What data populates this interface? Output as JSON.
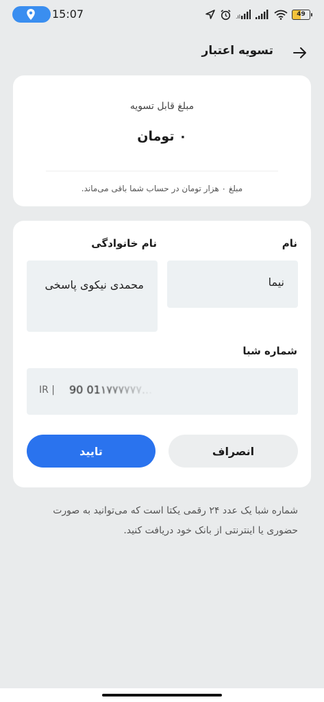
{
  "status_bar": {
    "time": "15:07",
    "battery": "49"
  },
  "header": {
    "title": "تسویه اعتبار"
  },
  "balance_card": {
    "label": "مبلغ قابل تسویه",
    "amount": "۰ تومان",
    "note": "مبلغ ۰ هزار تومان در حساب شما باقی می‌ماند."
  },
  "form": {
    "first_name_label": "نام",
    "first_name_value": "نیما",
    "last_name_label": "نام خانوادگی",
    "last_name_value": "محمدی نیکوی پاسخی",
    "sheba_label": "شماره شبا",
    "sheba_prefix": "IR |",
    "sheba_value": "90 01۱۷۷۷۷۷۷...",
    "cancel_label": "انصراف",
    "confirm_label": "تایید"
  },
  "info_text": "شماره شبا یک عدد ۲۴ رقمی یکتا است که می‌توانید به صورت حضوری یا اینترنتی از بانک خود دریافت کنید."
}
